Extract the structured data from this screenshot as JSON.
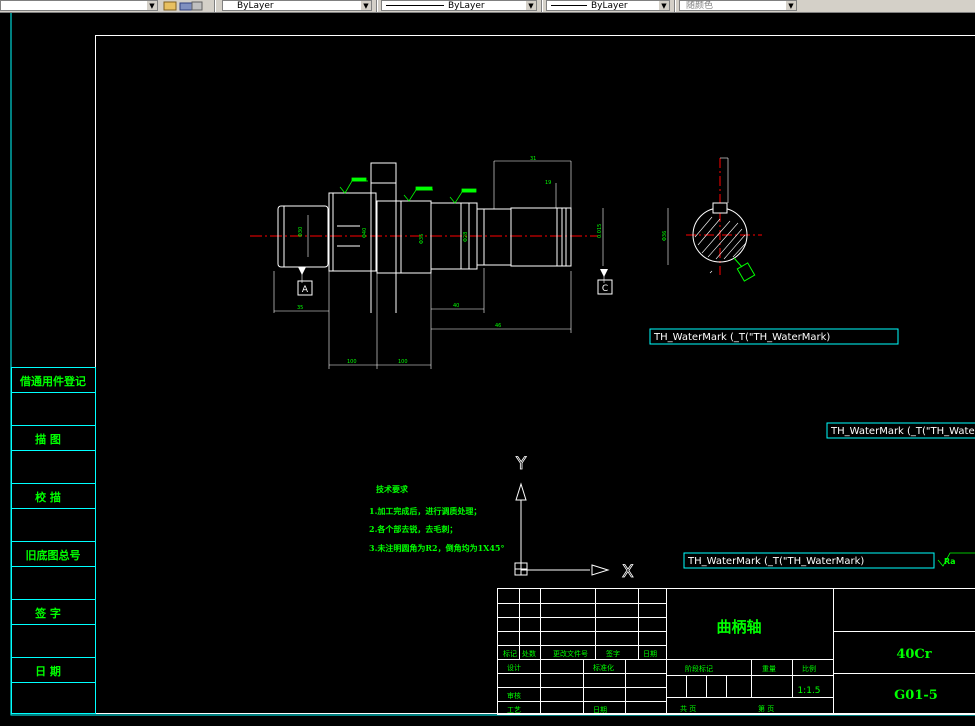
{
  "toolbar": {
    "combo_layer1": "ByLayer",
    "combo_layer2": "ByLayer",
    "combo_layer3": "ByLayer",
    "combo_color": "随颜色"
  },
  "left_panel": {
    "labels": [
      "借通用件登记",
      "描 图",
      "校 描",
      "旧底图总号",
      "签 字",
      "日 期"
    ]
  },
  "drawing": {
    "datum_a": "A",
    "datum_c": "C",
    "watermark_1": "TH_WaterMark (_T(\"TH_WaterMark)",
    "watermark_2": "TH_WaterMark (_T(\"TH_WaterMark)",
    "watermark_3": "TH_WaterMark (_T(\"TH_WaterMark)",
    "tech_title": "技术要求",
    "tech_notes": [
      "1.加工完成后，进行调质处理；",
      "2.各个部去锐，去毛刺；",
      "3.未注明圆角为R2，倒角均为1X45°"
    ],
    "ucs_x": "X",
    "ucs_y": "Y",
    "roughness_label": "Ra"
  },
  "title_block": {
    "part_name": "曲柄轴",
    "material": "40Cr",
    "drawing_no": "G01-5",
    "scale": "1:1.5",
    "revision_headers": [
      "标记",
      "处数",
      "更改文件号",
      "签字",
      "日期"
    ],
    "row_design": "设计",
    "row_standard": "标准化",
    "row_review": "审核",
    "row_process": "工艺",
    "row_approve": "日期",
    "stage_mark": "阶段标记",
    "weight": "重量",
    "scale_label": "比例",
    "total_sheets": "共 页",
    "sheet_no": "第 页"
  },
  "colors": {
    "background": "#000000",
    "border": "#00ffff",
    "geometry": "#ffffff",
    "text": "#00ff00",
    "centerline": "#ff0000"
  }
}
